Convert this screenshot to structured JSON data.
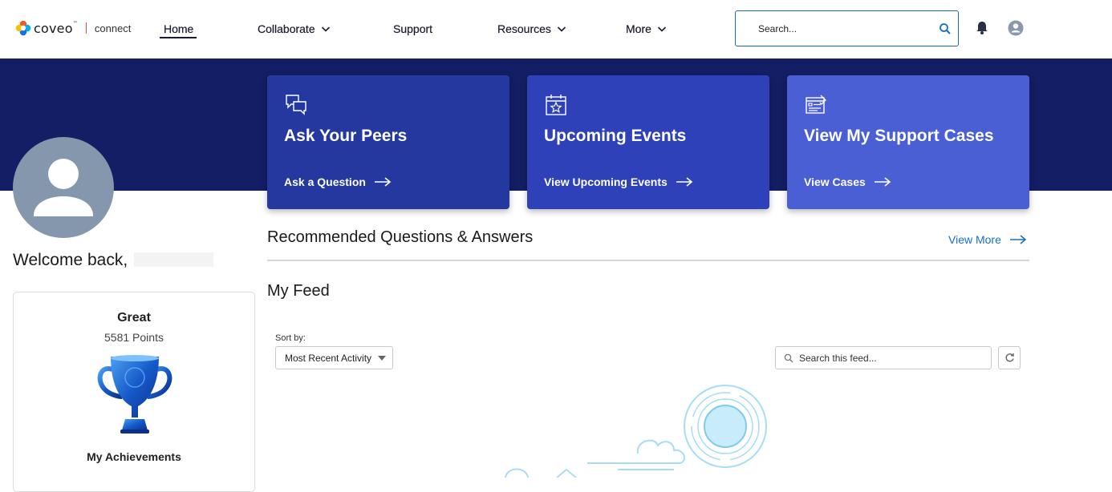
{
  "header": {
    "logo_text": "coveo",
    "logo_tm": "™",
    "logo_sub": "connect",
    "nav": [
      {
        "label": "Home",
        "active": true
      },
      {
        "label": "Collaborate",
        "dropdown": true
      },
      {
        "label": "Support"
      },
      {
        "label": "Resources",
        "dropdown": true
      },
      {
        "label": "More",
        "dropdown": true
      }
    ],
    "search_placeholder": "Search...",
    "icons": {
      "search": "search-icon",
      "notifications": "bell-icon",
      "profile": "user-avatar-icon"
    }
  },
  "colors": {
    "hero_band": "#131e64",
    "tile_1": "#2438a0",
    "tile_2": "#2f41b8",
    "tile_3": "#4a5fd4",
    "link_blue": "#1b6ec2",
    "avatar_bg": "#8497ad"
  },
  "tiles": [
    {
      "icon": "chat-bubbles-icon",
      "title": "Ask Your Peers",
      "link": "Ask a Question"
    },
    {
      "icon": "calendar-star-icon",
      "title": "Upcoming Events",
      "link": "View Upcoming Events"
    },
    {
      "icon": "support-case-form-icon",
      "title": "View My Support Cases",
      "link": "View Cases"
    }
  ],
  "profile": {
    "welcome": "Welcome back,",
    "achievement_level": "Great",
    "points": "5581 Points",
    "achievements_link": "My Achievements"
  },
  "recommended": {
    "title": "Recommended Questions & Answers",
    "view_more": "View More"
  },
  "feed": {
    "title": "My Feed",
    "sort_label": "Sort by:",
    "sort_value": "Most Recent Activity",
    "search_placeholder": "Search this feed..."
  }
}
